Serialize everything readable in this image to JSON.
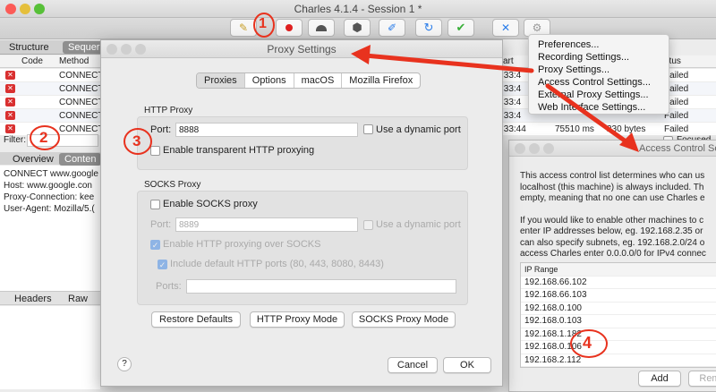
{
  "window": {
    "title": "Charles 4.1.4 - Session 1 *"
  },
  "toolbar": {
    "icons": [
      "broom-icon",
      "record-icon",
      "turtle-icon",
      "hexagon-stop-icon",
      "pen-icon",
      "refresh-icon",
      "check-icon",
      "tools-icon",
      "gear-icon"
    ]
  },
  "left_tabs": {
    "structure": "Structure",
    "sequence": "Sequer"
  },
  "table": {
    "headers": {
      "code": "Code",
      "method": "Method",
      "status_col_a": "art",
      "status_col_b": "atus"
    },
    "rows": [
      {
        "method": "CONNECT",
        "time": ":33:4",
        "status": "Failed"
      },
      {
        "method": "CONNECT",
        "time": ":33:4",
        "status": "Failed"
      },
      {
        "method": "CONNECT",
        "time": ":33:4",
        "status": "Failed"
      },
      {
        "method": "CONNECT",
        "time": ":33:4",
        "status": "Failed"
      },
      {
        "method": "CONNECT",
        "time": ":33:44",
        "size": "75510 ms",
        "bytes": "230 bytes",
        "status": "Failed"
      }
    ]
  },
  "filter": {
    "label": "Filter:",
    "focused_label": "Focused"
  },
  "detail_tabs": {
    "overview": "Overview",
    "contents": "Conten"
  },
  "request_lines": [
    "CONNECT www.google",
    "Host: www.google.con",
    "Proxy-Connection: kee",
    "User-Agent: Mozilla/5.("
  ],
  "bottom_tabs": {
    "headers": "Headers",
    "raw": "Raw"
  },
  "dialog": {
    "title": "Proxy Settings",
    "tabs": [
      "Proxies",
      "Options",
      "macOS",
      "Mozilla Firefox"
    ],
    "http": {
      "section": "HTTP Proxy",
      "port_label": "Port:",
      "port_value": "8888",
      "dynamic_label": "Use a dynamic port",
      "transparent_label": "Enable transparent HTTP proxying"
    },
    "socks": {
      "section": "SOCKS Proxy",
      "enable_label": "Enable SOCKS proxy",
      "port_label": "Port:",
      "port_value": "8889",
      "dynamic_label": "Use a dynamic port",
      "http_over_label": "Enable HTTP proxying over SOCKS",
      "default_ports_label": "Include default HTTP ports (80, 443, 8080, 8443)",
      "ports_label": "Ports:"
    },
    "buttons": {
      "restore": "Restore Defaults",
      "http_mode": "HTTP Proxy Mode",
      "socks_mode": "SOCKS Proxy Mode",
      "cancel": "Cancel",
      "ok": "OK",
      "help": "?"
    }
  },
  "menu": {
    "items": [
      "Preferences...",
      "Recording Settings...",
      "Proxy Settings...",
      "Access Control Settings...",
      "External Proxy Settings...",
      "Web Interface Settings..."
    ]
  },
  "access": {
    "title": "Access Control Se",
    "text": [
      "This access control list determines who can us",
      "localhost (this machine) is always included. Th",
      "empty, meaning that no one can use Charles e",
      "",
      "If you would like to enable other machines to c",
      "enter IP addresses below, eg. 192.168.2.35 or ",
      "can also specify subnets, eg. 192.168.2.0/24 o",
      "access Charles enter 0.0.0.0/0 for IPv4 connec"
    ],
    "ip_header": "IP Range",
    "ips": [
      "192.168.66.102",
      "192.168.66.103",
      "192.168.0.100",
      "192.168.0.103",
      "192.168.1.182",
      "192.168.0.106",
      "192.168.2.112"
    ],
    "add_label": "Add",
    "remove_label": "Rem"
  },
  "annotations": {
    "n1": "1",
    "n2": "2",
    "n3": "3",
    "n4": "4"
  },
  "colors": {
    "annotation": "#e8321e",
    "accent": "#2a7dea"
  }
}
